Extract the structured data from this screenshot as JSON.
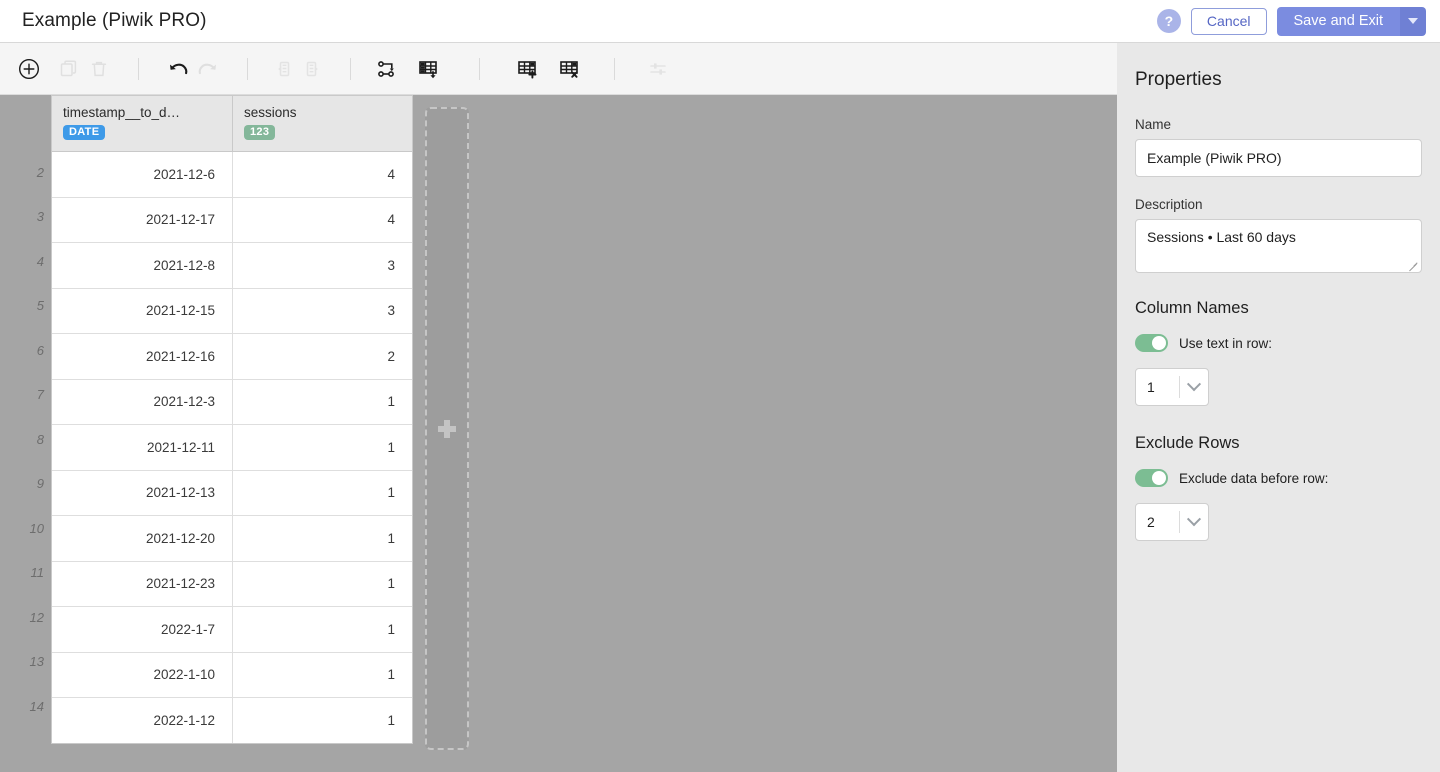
{
  "header": {
    "title": "Example (Piwik PRO)",
    "help_icon": "question-mark-icon",
    "cancel_label": "Cancel",
    "save_label": "Save and Exit",
    "save_caret_icon": "chevron-down-icon"
  },
  "toolbar": {
    "items": [
      {
        "name": "add-step-button",
        "icon": "plus-circle-icon",
        "disabled": false
      },
      {
        "name": "duplicate-button",
        "icon": "copy-icon",
        "disabled": true
      },
      {
        "name": "delete-button",
        "icon": "trash-icon",
        "disabled": true
      },
      {
        "name": "undo-button",
        "icon": "undo-arrow-icon",
        "disabled": false
      },
      {
        "name": "redo-button",
        "icon": "redo-arrow-icon",
        "disabled": true
      },
      {
        "name": "move-column-left-button",
        "icon": "move-left-icon",
        "disabled": true
      },
      {
        "name": "move-column-right-button",
        "icon": "move-right-icon",
        "disabled": true
      },
      {
        "name": "join-tables-button",
        "icon": "join-nodes-icon",
        "disabled": false
      },
      {
        "name": "append-rows-button",
        "icon": "table-append-down-icon",
        "disabled": false
      },
      {
        "name": "add-column-button",
        "icon": "table-plus-icon",
        "disabled": false
      },
      {
        "name": "remove-column-button",
        "icon": "table-remove-icon",
        "disabled": false
      },
      {
        "name": "settings-sliders-button",
        "icon": "sliders-icon",
        "disabled": true
      }
    ]
  },
  "grid": {
    "columns": [
      {
        "name": "timestamp__to_d…",
        "type_badge": "DATE",
        "badge_color": "#3e9ae8"
      },
      {
        "name": "sessions",
        "type_badge": "123",
        "badge_color": "#84b79a"
      }
    ],
    "rows": [
      {
        "num": "2",
        "date": "2021-12-6",
        "sessions": "4"
      },
      {
        "num": "3",
        "date": "2021-12-17",
        "sessions": "4"
      },
      {
        "num": "4",
        "date": "2021-12-8",
        "sessions": "3"
      },
      {
        "num": "5",
        "date": "2021-12-15",
        "sessions": "3"
      },
      {
        "num": "6",
        "date": "2021-12-16",
        "sessions": "2"
      },
      {
        "num": "7",
        "date": "2021-12-3",
        "sessions": "1"
      },
      {
        "num": "8",
        "date": "2021-12-11",
        "sessions": "1"
      },
      {
        "num": "9",
        "date": "2021-12-13",
        "sessions": "1"
      },
      {
        "num": "10",
        "date": "2021-12-20",
        "sessions": "1"
      },
      {
        "num": "11",
        "date": "2021-12-23",
        "sessions": "1"
      },
      {
        "num": "12",
        "date": "2022-1-7",
        "sessions": "1"
      },
      {
        "num": "13",
        "date": "2022-1-10",
        "sessions": "1"
      },
      {
        "num": "14",
        "date": "2022-1-12",
        "sessions": "1"
      }
    ],
    "add_column_placeholder_icon": "plus-icon"
  },
  "panel": {
    "title": "Properties",
    "name_label": "Name",
    "name_value": "Example (Piwik PRO)",
    "description_label": "Description",
    "description_value": "Sessions • Last 60 days",
    "column_names": {
      "section_title": "Column Names",
      "toggle_label": "Use text in row:",
      "toggle_on": true,
      "row_value": "1",
      "chevron_icon": "chevron-down-icon"
    },
    "exclude_rows": {
      "section_title": "Exclude Rows",
      "toggle_label": "Exclude data before row:",
      "toggle_on": true,
      "row_value": "2",
      "chevron_icon": "chevron-down-icon"
    }
  },
  "colors": {
    "accent": "#7b8ce0",
    "toggle_on": "#7cbd93",
    "date_badge": "#3e9ae8",
    "number_badge": "#84b79a",
    "canvas": "#a5a5a5"
  }
}
